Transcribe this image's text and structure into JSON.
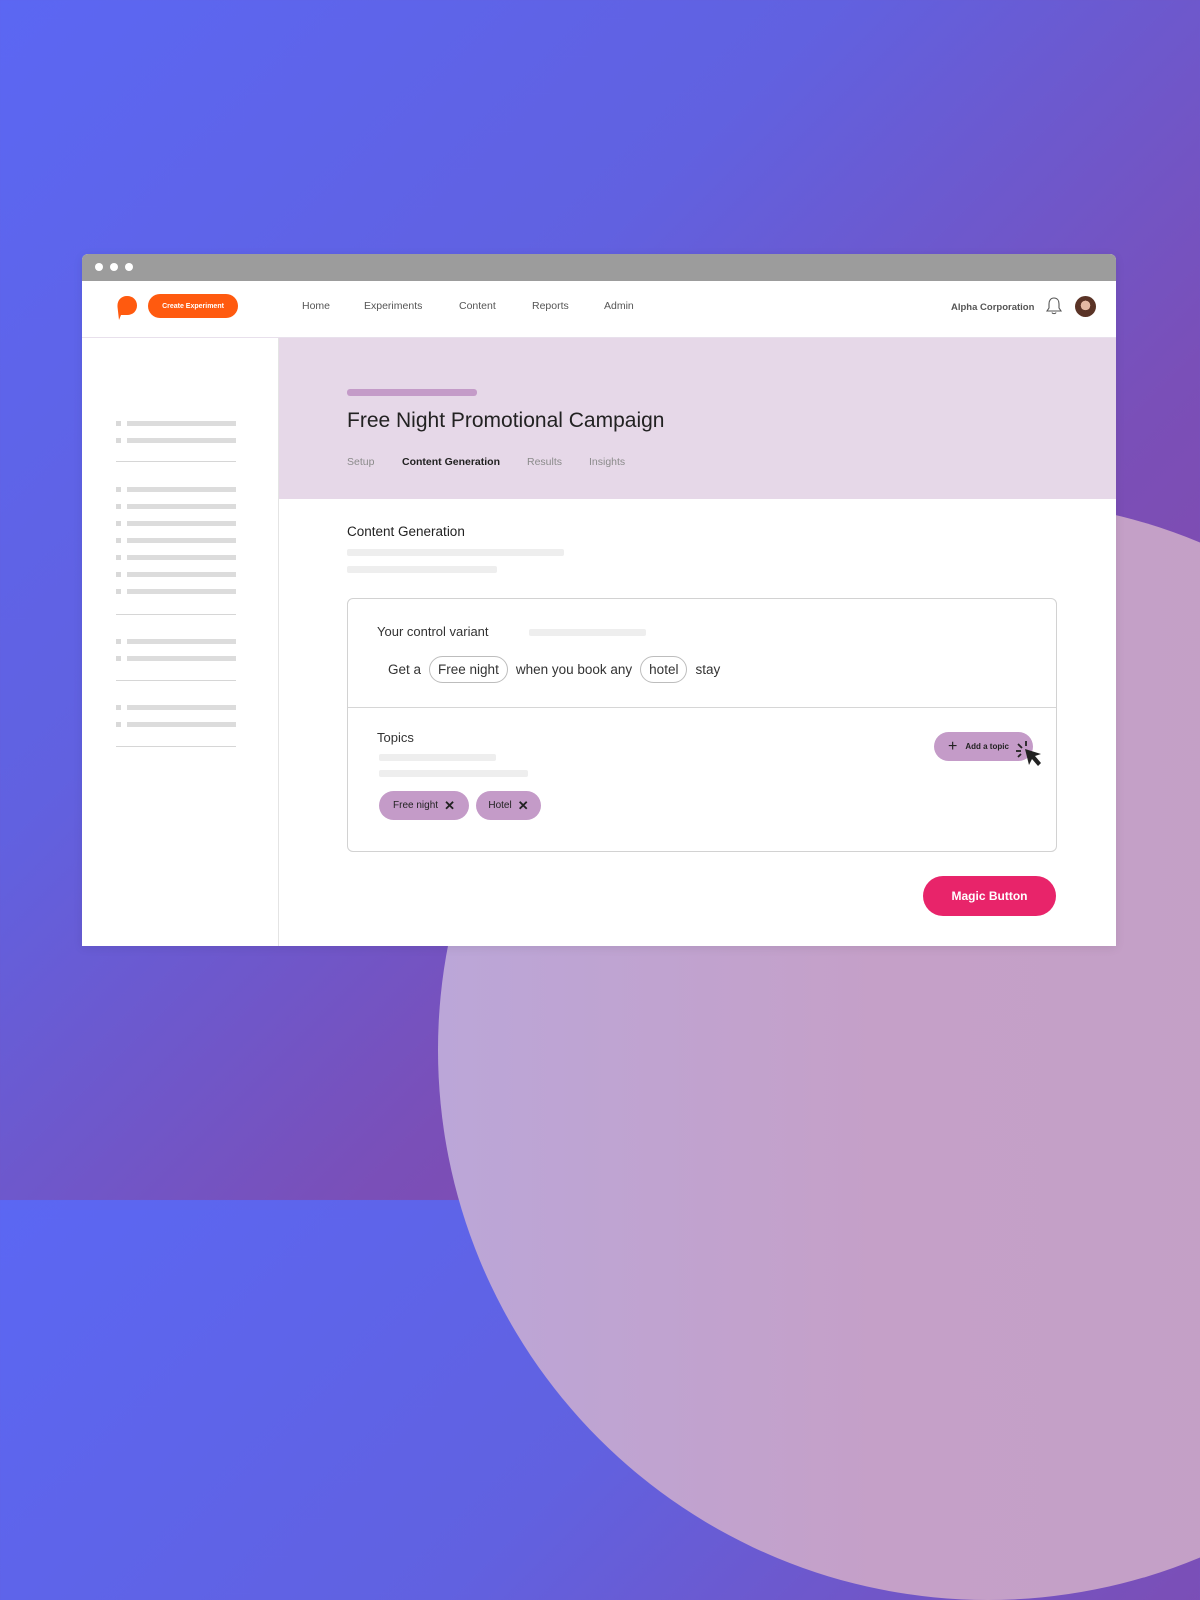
{
  "window": {
    "controls": [
      "dot",
      "dot",
      "dot"
    ]
  },
  "topnav": {
    "logo_icon": "speech-bubble-logo",
    "create_button": "Create Experiment",
    "links": [
      "Home",
      "Experiments",
      "Content",
      "Reports",
      "Admin"
    ],
    "organization": "Alpha Corporation",
    "bell_icon": "bell-icon",
    "avatar": "user-avatar"
  },
  "header": {
    "title": "Free Night Promotional Campaign",
    "tabs": [
      {
        "label": "Setup",
        "active": false
      },
      {
        "label": "Content Generation",
        "active": true
      },
      {
        "label": "Results",
        "active": false
      },
      {
        "label": "Insights",
        "active": false
      }
    ]
  },
  "main": {
    "section_title": "Content Generation",
    "control_variant": {
      "label": "Your control variant",
      "sentence": {
        "part1": "Get a",
        "slot1": "Free night",
        "part2": "when you book any",
        "slot2": "hotel",
        "part3": "stay"
      }
    },
    "topics": {
      "label": "Topics",
      "add_button": "Add a topic",
      "chips": [
        "Free night",
        "Hotel"
      ],
      "remove_glyph": "✕"
    },
    "magic_button": "Magic Button"
  },
  "colors": {
    "brand_orange": "#ff5a0f",
    "accent_pink": "#e8246a",
    "chip_purple": "#c49bc8",
    "header_band": "#e6d8e8"
  }
}
